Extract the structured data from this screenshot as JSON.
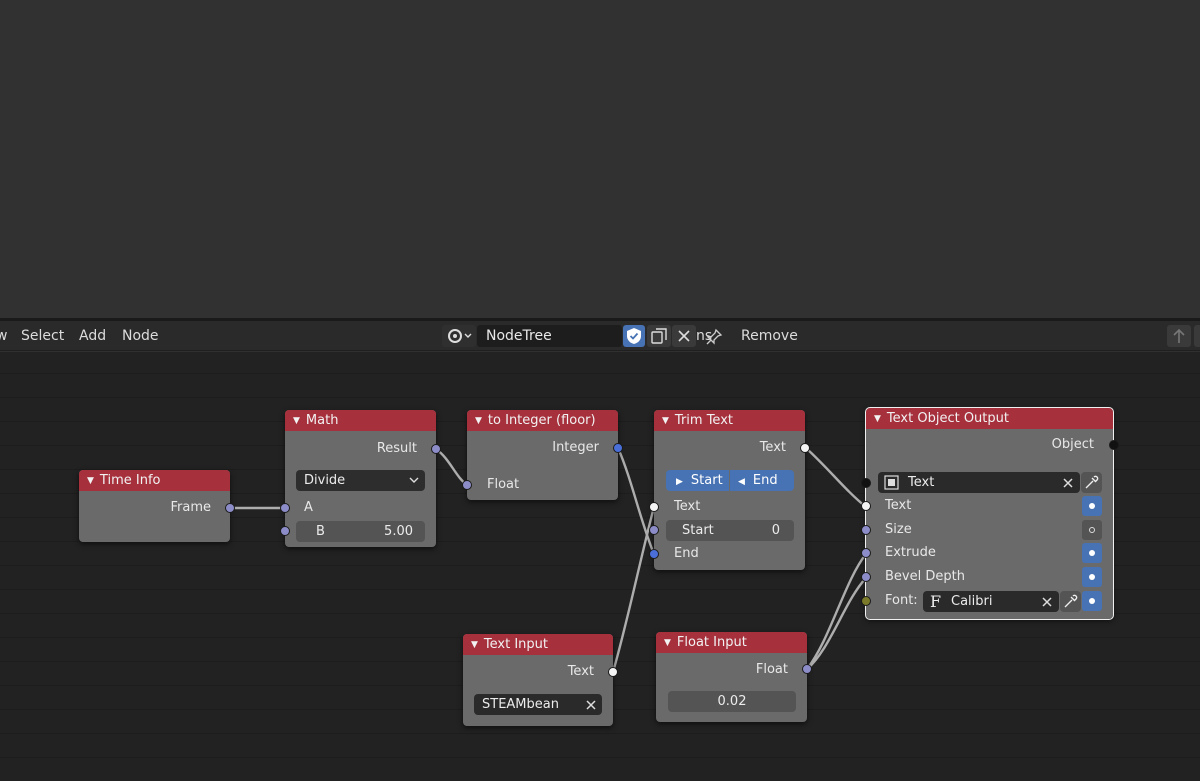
{
  "header": {
    "menus": [
      "w",
      "Select",
      "Add",
      "Node"
    ],
    "tree_name": "NodeTree",
    "ns_text": "ns",
    "remove_label": "Remove"
  },
  "nodes": {
    "time_info": {
      "title": "Time Info",
      "out_frame": "Frame"
    },
    "math": {
      "title": "Math",
      "out_result": "Result",
      "operation": "Divide",
      "in_a": "A",
      "in_b": "B",
      "b_value": "5.00"
    },
    "to_integer": {
      "title": "to Integer (floor)",
      "out_integer": "Integer",
      "in_float": "Float"
    },
    "trim_text": {
      "title": "Trim Text",
      "out_text": "Text",
      "mode_start": "Start",
      "mode_end": "End",
      "in_text": "Text",
      "in_start": "Start",
      "start_value": "0",
      "in_end": "End"
    },
    "text_input": {
      "title": "Text Input",
      "out_text": "Text",
      "value": "STEAMbean"
    },
    "float_input": {
      "title": "Float Input",
      "out_float": "Float",
      "value": "0.02"
    },
    "text_output": {
      "title": "Text Object Output",
      "out_object": "Object",
      "object_name": "Text",
      "in_text": "Text",
      "in_size": "Size",
      "in_extrude": "Extrude",
      "in_bevel": "Bevel Depth",
      "font_label": "Font:",
      "font_name": "Calibri"
    }
  },
  "colors": {
    "header_red": "#a6303c",
    "node_body": "#6a6a6a",
    "accent_blue": "#4772b3",
    "link": "#b8b8b8"
  }
}
